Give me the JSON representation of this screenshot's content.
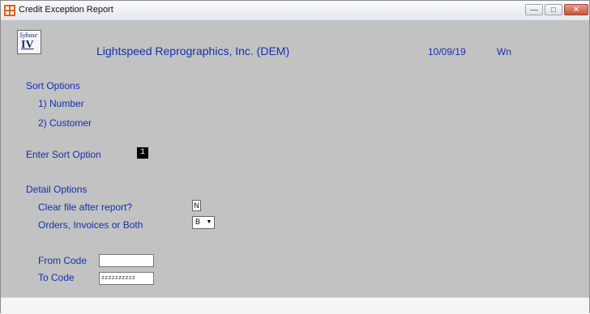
{
  "window": {
    "title": "Credit Exception Report",
    "minimize_glyph": "—",
    "maximize_glyph": "□",
    "close_glyph": "✕"
  },
  "header": {
    "logo_script": "Sybase",
    "logo_roman": "IV",
    "company": "Lightspeed Reprographics, Inc. (DEM)",
    "date": "10/09/19",
    "user": "Wn"
  },
  "sort": {
    "heading": "Sort Options",
    "option1": "1) Number",
    "option2": "2) Customer",
    "enter_label": "Enter Sort Option",
    "value": "1"
  },
  "detail": {
    "heading": "Detail Options",
    "clear_label": "Clear file after report?",
    "clear_value": "N",
    "type_label": "Orders, Invoices or Both",
    "type_value": "B",
    "dropdown_icon": "▼"
  },
  "range": {
    "from_label": "From Code",
    "from_value": "",
    "to_label": "To Code",
    "to_value": "zzzzzzzzzz"
  },
  "colors": {
    "label_blue": "#1330b0",
    "background": "#c2c2c2"
  }
}
